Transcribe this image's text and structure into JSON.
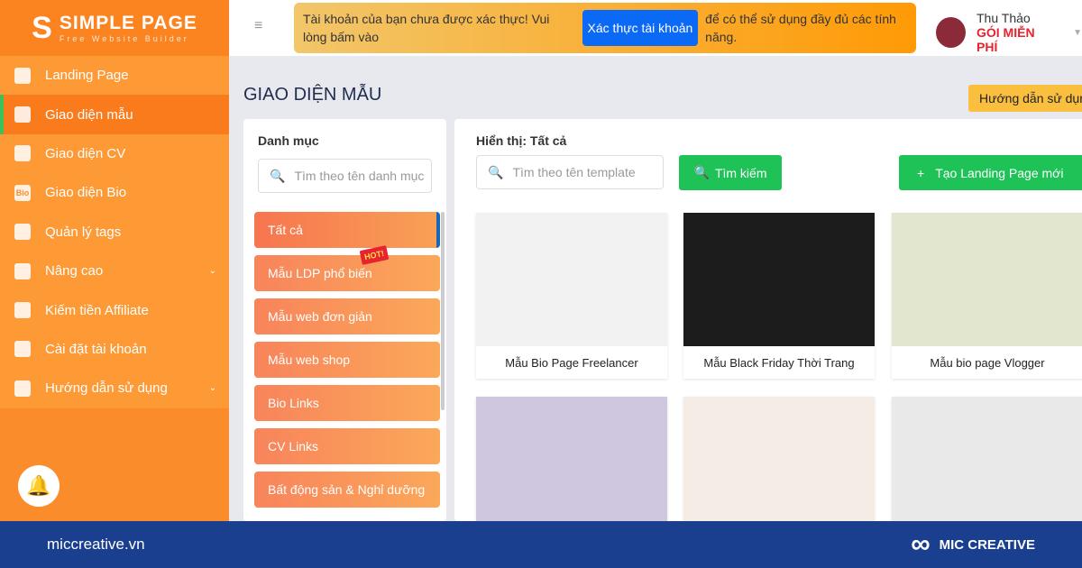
{
  "logo": {
    "title": "SIMPLE PAGE",
    "subtitle": "Free Website Builder"
  },
  "sidebar": {
    "items": [
      {
        "label": "Landing Page",
        "icon": "box-icon"
      },
      {
        "label": "Giao diện mẫu",
        "icon": "template-icon",
        "active": true
      },
      {
        "label": "Giao diện CV",
        "icon": "id-card-icon"
      },
      {
        "label": "Giao diện Bio",
        "icon": "bio-icon",
        "icon_text": "Bio"
      },
      {
        "label": "Quản lý tags",
        "icon": "list-icon"
      },
      {
        "label": "Nâng cao",
        "icon": "plus-circle-icon",
        "chevron": true
      },
      {
        "label": "Kiếm tiền Affiliate",
        "icon": "copy-icon"
      },
      {
        "label": "Cài đặt tài khoản",
        "icon": "gear-icon"
      },
      {
        "label": "Hướng dẫn sử dụng",
        "icon": "help-icon",
        "chevron": true
      }
    ]
  },
  "alert": {
    "text_before": "Tài khoản của bạn chưa được xác thực! Vui lòng bấm vào",
    "button": "Xác thực tài khoản",
    "text_after": "để có thể sử dụng đầy đủ các tính năng."
  },
  "user": {
    "name": "Thu Thảo",
    "plan": "GÓI MIỄN PHÍ"
  },
  "page_title": "GIAO DIỆN MẪU",
  "guide_button": "Hướng dẫn sử dụng",
  "categories": {
    "heading": "Danh mục",
    "search_placeholder": "Tìm theo tên danh mục",
    "hot_badge": "HOT!",
    "items": [
      "Tất cả",
      "Mẫu LDP phổ biến",
      "Mẫu web đơn giản",
      "Mẫu web shop",
      "Bio Links",
      "CV Links",
      "Bất động sản & Nghỉ dưỡng"
    ]
  },
  "templates": {
    "heading": "Hiển thị: Tất cả",
    "search_placeholder": "Tìm theo tên template",
    "search_button": "Tìm kiếm",
    "new_button": "Tạo Landing Page mới",
    "cards": [
      {
        "label": "Mẫu Bio Page Freelancer",
        "color": "#f2f2f2"
      },
      {
        "label": "Mẫu Black Friday Thời Trang",
        "color": "#1c1c1c"
      },
      {
        "label": "Mẫu bio page Vlogger",
        "color": "#e3e6cf"
      },
      {
        "label": "",
        "color": "#cfc6e0"
      },
      {
        "label": "",
        "color": "#f5ece6"
      },
      {
        "label": "",
        "color": "#e9e9e9"
      }
    ]
  },
  "footer": {
    "site": "miccreative.vn",
    "brand": "MIC CREATIVE"
  }
}
